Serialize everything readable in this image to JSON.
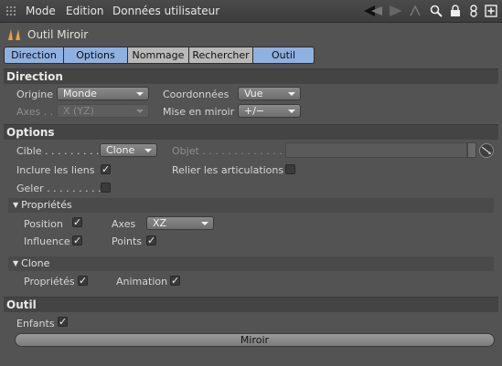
{
  "menu": {
    "mode": "Mode",
    "edition": "Edition",
    "donnees": "Données utilisateur"
  },
  "title": "Outil Miroir",
  "tabs": [
    {
      "label": "Direction",
      "active": true
    },
    {
      "label": "Options",
      "active": true
    },
    {
      "label": "Nommage",
      "active": false
    },
    {
      "label": "Rechercher",
      "active": false
    },
    {
      "label": "Outil",
      "active": true
    }
  ],
  "direction": {
    "header": "Direction",
    "origine_label": "Origine",
    "origine_value": "Monde",
    "coord_label": "Coordonnées",
    "coord_value": "Vue",
    "axes_label": "Axes . .",
    "axes_value": "X (YZ)",
    "miroir_label": "Mise en miroir",
    "miroir_value": "+/−"
  },
  "options": {
    "header": "Options",
    "cible_label": "Cible . . . . . . . . .",
    "cible_value": "Clone",
    "objet_label": "Objet . . . . . . . . . . . . . . .",
    "inclure_label": "Inclure les  liens",
    "inclure_checked": true,
    "relier_label": "Relier les articulations",
    "relier_checked": false,
    "geler_label": "Geler . . . . . . . . .",
    "geler_checked": false
  },
  "proprietes": {
    "header": "Propriétés",
    "position_label": "Position",
    "position_checked": true,
    "axes_label": "Axes",
    "axes_value": "XZ",
    "influence_label": "Influence",
    "influence_checked": true,
    "points_label": "Points",
    "points_checked": true
  },
  "clone": {
    "header": "Clone",
    "proprietes_label": "Propriétés",
    "proprietes_checked": true,
    "animation_label": "Animation",
    "animation_checked": true
  },
  "outil": {
    "header": "Outil",
    "enfants_label": "Enfants",
    "enfants_checked": true,
    "miroir_button": "Miroir"
  },
  "colors": {
    "tab_active": "#8fb1e0",
    "tab_inactive": "#b9b9b9",
    "background": "#535353"
  }
}
